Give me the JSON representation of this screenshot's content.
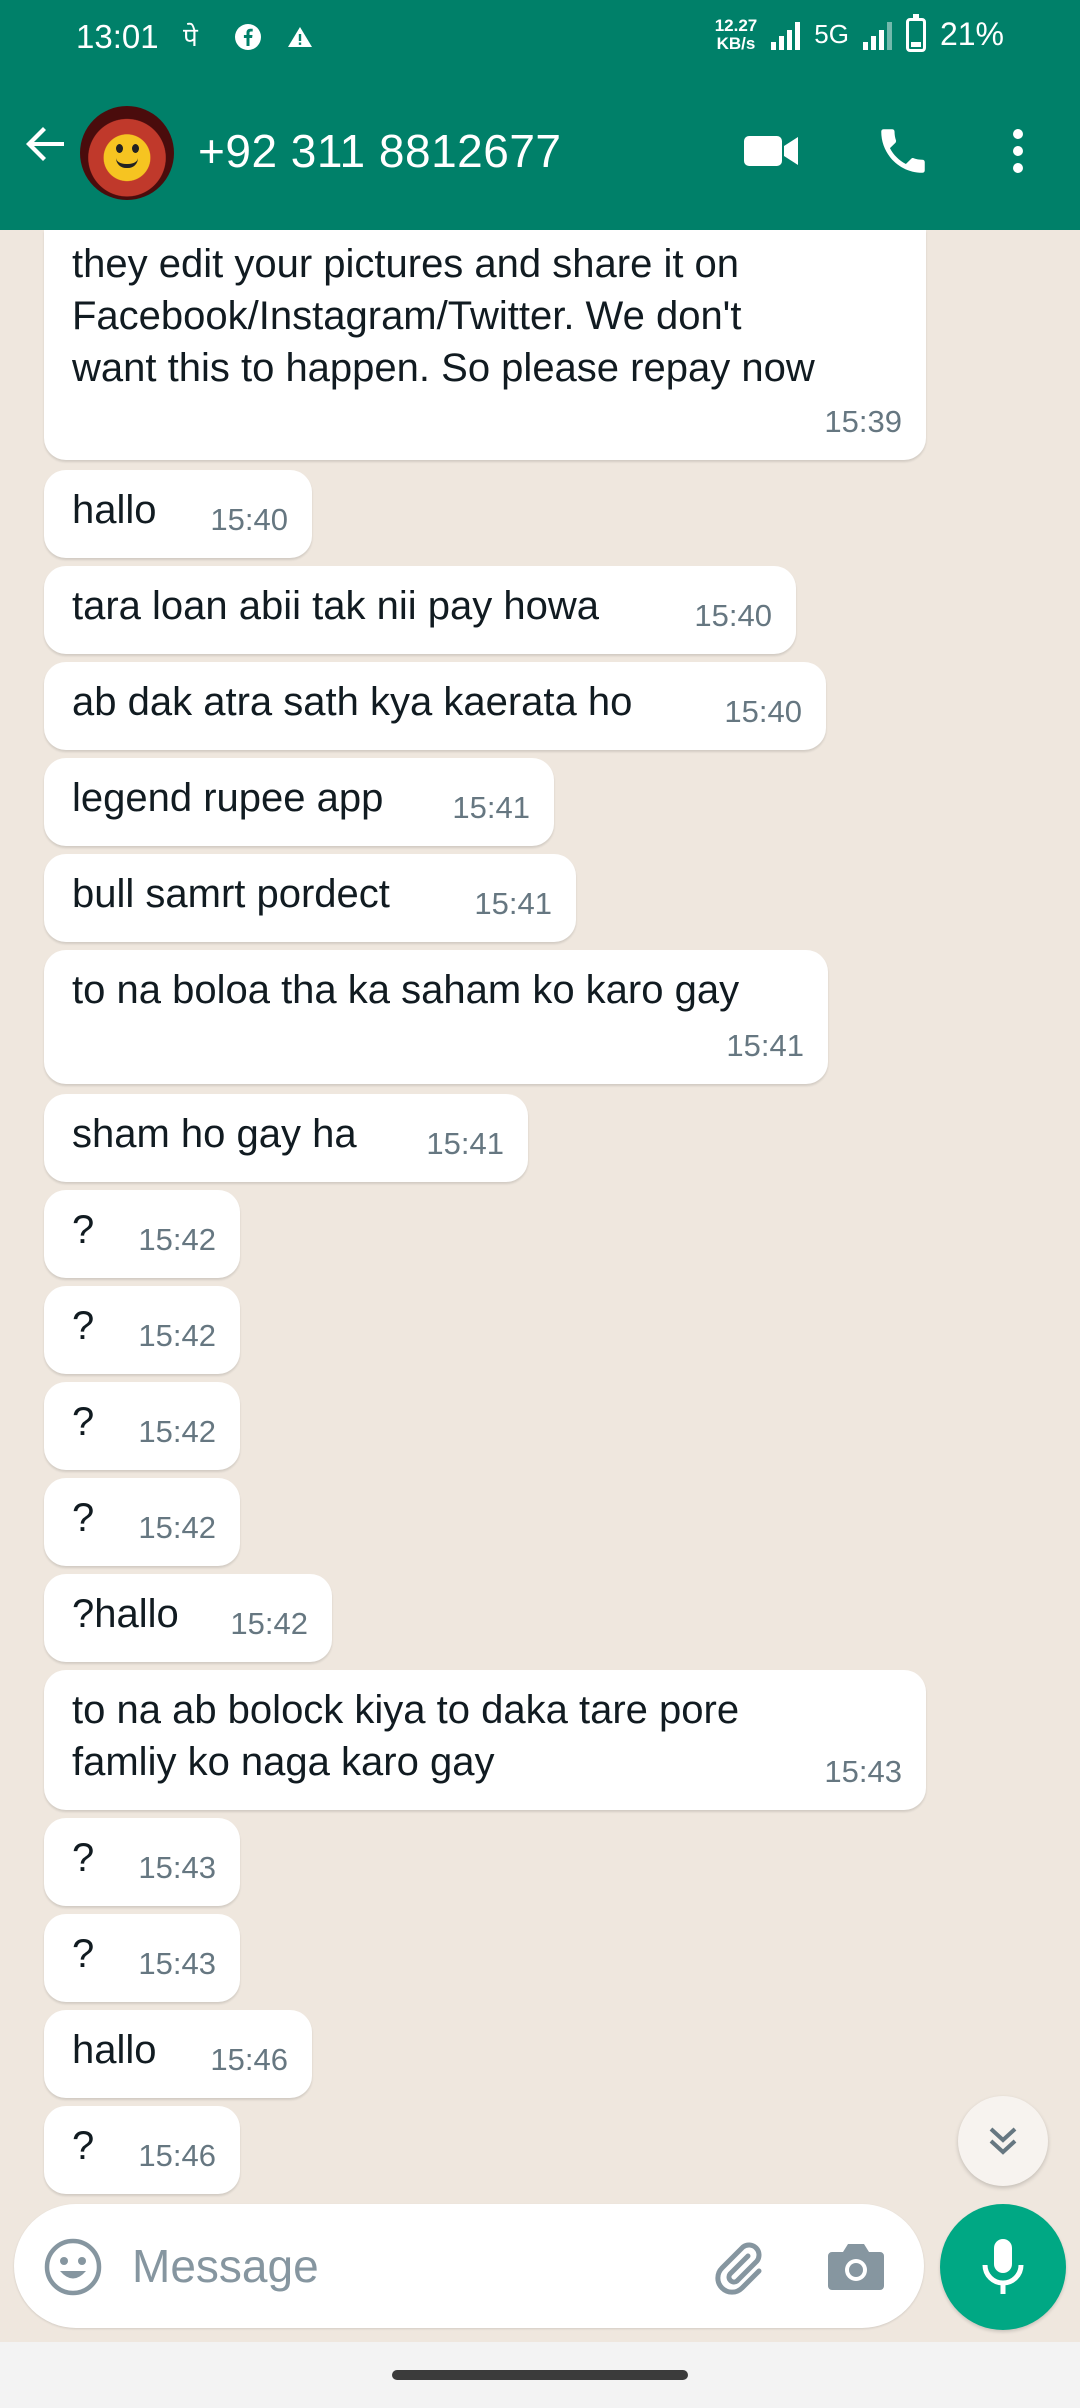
{
  "status_bar": {
    "time": "13:01",
    "notif_icons": [
      "pe-icon",
      "facebook-icon",
      "alert-icon"
    ],
    "net_speed_value": "12.27",
    "net_speed_unit": "KB/s",
    "network": "5G",
    "battery": "21%"
  },
  "header": {
    "contact": "+92 311 8812677"
  },
  "messages": [
    {
      "text": "they edit your pictures and share it on\nFacebook/Instagram/Twitter. We don't\nwant this to happen. So please repay now",
      "time": "15:39"
    },
    {
      "text": "hallo",
      "time": "15:40"
    },
    {
      "text": "tara loan abii tak nii pay howa",
      "time": "15:40"
    },
    {
      "text": "ab dak atra sath kya kaerata ho",
      "time": "15:40"
    },
    {
      "text": "legend rupee app",
      "time": "15:41"
    },
    {
      "text": "bull samrt pordect",
      "time": "15:41"
    },
    {
      "text": "to na boloa tha ka saham ko karo gay",
      "time": "15:41"
    },
    {
      "text": "sham ho gay ha",
      "time": "15:41"
    },
    {
      "text": "?",
      "time": "15:42"
    },
    {
      "text": "?",
      "time": "15:42"
    },
    {
      "text": "?",
      "time": "15:42"
    },
    {
      "text": "?",
      "time": "15:42"
    },
    {
      "text": "?hallo",
      "time": "15:42"
    },
    {
      "text": "to na ab bolock kiya to daka tare pore\nfamliy ko naga karo gay",
      "time": "15:43"
    },
    {
      "text": "?",
      "time": "15:43"
    },
    {
      "text": "?",
      "time": "15:43"
    },
    {
      "text": "hallo",
      "time": "15:46"
    },
    {
      "text": "?",
      "time": "15:46"
    }
  ],
  "composer": {
    "placeholder": "Message"
  },
  "colors": {
    "header": "#008069",
    "chat_bg": "#efe7de",
    "bubble": "#ffffff",
    "mic": "#00a884",
    "timestamp": "#667781"
  }
}
